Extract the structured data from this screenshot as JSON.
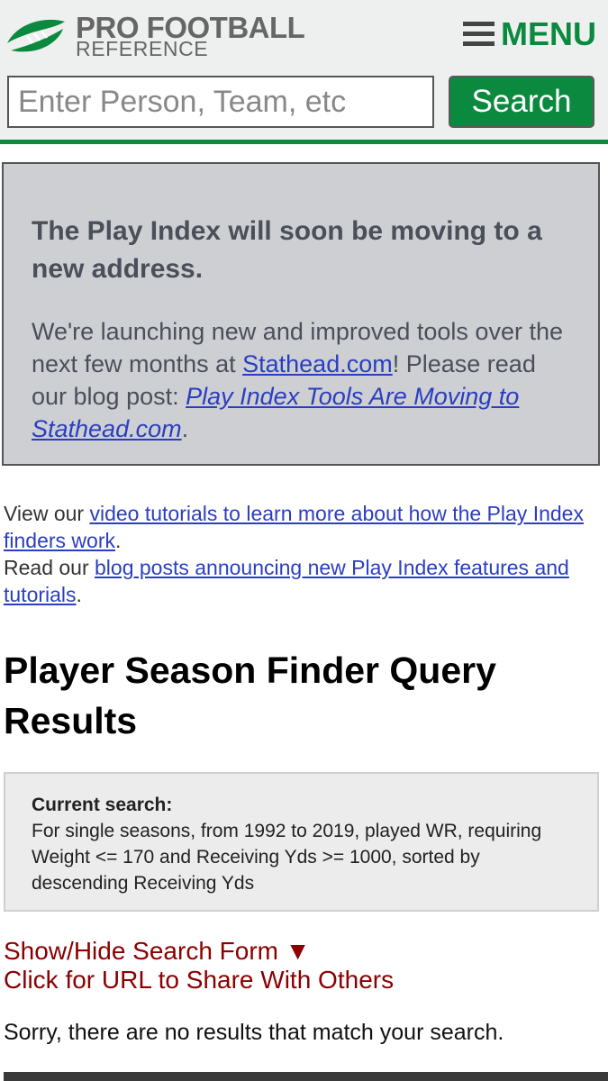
{
  "header": {
    "logo_line1": "PRO FOOTBALL",
    "logo_line2": "REFERENCE",
    "menu_label": "MENU",
    "search_placeholder": "Enter Person, Team, etc",
    "search_button": "Search",
    "accent_color": "#0b8a3f"
  },
  "notice": {
    "heading": "The Play Index will soon be moving to a new address.",
    "body_pre": "We're launching new and improved tools over the next few months at ",
    "link1": "Stathead.com",
    "body_mid": "! Please read our blog post: ",
    "link2": "Play Index Tools Are Moving to Stathead.com",
    "body_post": "."
  },
  "tutorials": {
    "line1_pre": "View our ",
    "line1_link": "video tutorials to learn more about how the Play Index finders work",
    "line1_post": ".",
    "line2_pre": "Read our ",
    "line2_link": "blog posts announcing new Play Index features and tutorials",
    "line2_post": "."
  },
  "page_title": "Player Season Finder Query Results",
  "current_search": {
    "label": "Current search:",
    "text": "For single seasons, from 1992 to 2019, played WR, requiring Weight <= 170 and Receiving Yds >= 1000, sorted by descending Receiving Yds"
  },
  "form_links": {
    "show_hide": "Show/Hide Search Form ▼",
    "share_url": "Click for URL to Share With Others"
  },
  "no_results": "Sorry, there are no results that match your search."
}
